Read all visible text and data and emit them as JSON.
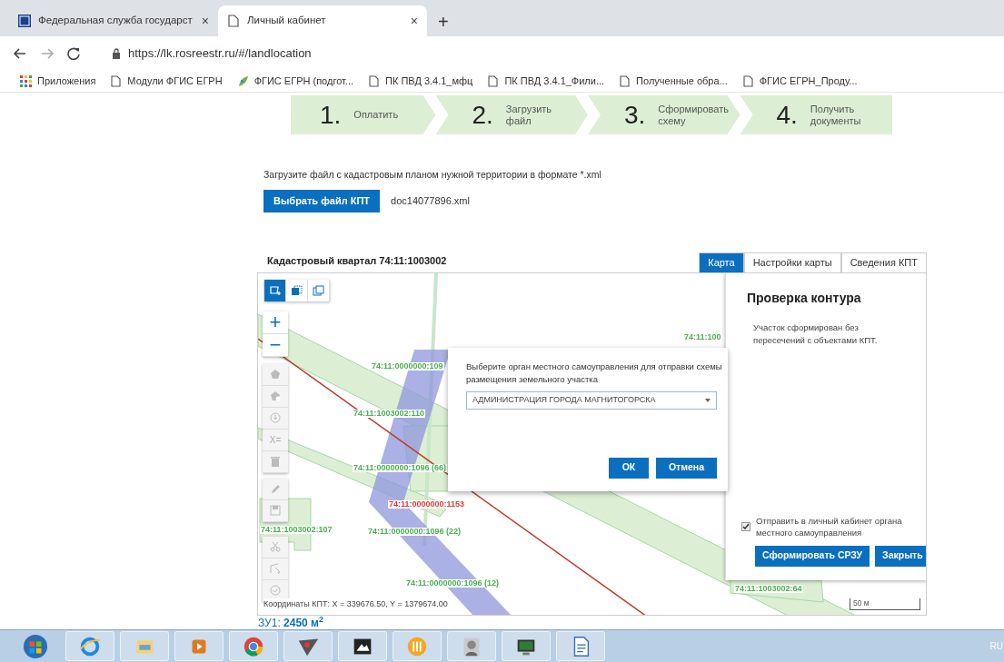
{
  "browser": {
    "tabs": [
      {
        "title": "Федеральная служба государст",
        "kind": "site",
        "selected": false,
        "close": "×"
      },
      {
        "title": "Личный кабинет",
        "kind": "page",
        "selected": true,
        "close": "×"
      }
    ],
    "new_tab": "+",
    "url": "https://lk.rosreestr.ru/#/landlocation",
    "bookmarks": [
      {
        "label": "Приложения",
        "kind": "apps"
      },
      {
        "label": "Модули ФГИС ЕГРН",
        "kind": "page"
      },
      {
        "label": "ФГИС ЕГРН (подгот...",
        "kind": "leaf"
      },
      {
        "label": "ПК ПВД 3.4.1_мфц",
        "kind": "page"
      },
      {
        "label": "ПК ПВД 3.4.1_Фили...",
        "kind": "page"
      },
      {
        "label": "Полученные обра...",
        "kind": "page"
      },
      {
        "label": "ФГИС ЕГРН_Проду...",
        "kind": "page"
      }
    ]
  },
  "steps": [
    {
      "number": "1.",
      "label": "Оплатить"
    },
    {
      "number": "2.",
      "label": "Загрузить файл"
    },
    {
      "number": "3.",
      "label": "Сформировать схему"
    },
    {
      "number": "4.",
      "label": "Получить документы"
    }
  ],
  "upload": {
    "prompt": "Загрузите файл с кадастровым планом нужной территории в формате *.xml",
    "button": "Выбрать файл КПТ",
    "file_name": "doc14077896.xml"
  },
  "map": {
    "title": "Кадастровый квартал 74:11:1003002",
    "tabs": [
      {
        "label": "Карта",
        "selected": true
      },
      {
        "label": "Настройки карты",
        "selected": false
      },
      {
        "label": "Сведения КПТ",
        "selected": false
      }
    ],
    "modes": [
      {
        "kind": "draw",
        "selected": true
      },
      {
        "kind": "select",
        "selected": false
      },
      {
        "kind": "layers",
        "selected": false
      }
    ],
    "zoom": [
      "+",
      "−"
    ],
    "tool_groups": [
      [
        {
          "kind": "polygon"
        },
        {
          "kind": "polygon-hole"
        },
        {
          "kind": "import"
        },
        {
          "kind": "coords",
          "label": "X="
        },
        {
          "kind": "delete"
        }
      ],
      [
        {
          "kind": "edit"
        },
        {
          "kind": "save"
        }
      ],
      [
        {
          "kind": "cut"
        },
        {
          "kind": "vertex"
        },
        {
          "kind": "check"
        }
      ]
    ],
    "labels": [
      {
        "text": "74:11:0000000:109",
        "color": "#4caf50"
      },
      {
        "text": "74:11:1003002:110",
        "color": "#4caf50"
      },
      {
        "text": "74:11:0000000:1096 (66)",
        "color": "#4caf50"
      },
      {
        "text": "74:11:0000000:1153",
        "color": "#e53935"
      },
      {
        "text": "74:11:1003002:107",
        "color": "#4caf50"
      },
      {
        "text": "74:11:0000000:1096 (22)",
        "color": "#4caf50"
      },
      {
        "text": "74:11:0000000:1096 (12)",
        "color": "#4caf50"
      },
      {
        "text": "74:11:100",
        "color": "#4caf50"
      },
      {
        "text": "74:11:1003002:64",
        "color": "#4caf50"
      }
    ],
    "coordinates": "Координаты КПТ: X = 339676.50, Y = 1379674.00",
    "scale": "50 м",
    "dialog": {
      "message": "Выберите орган местного самоуправления для отправки схемы размещения земельного участка",
      "select_value": "АДМИНИСТРАЦИЯ ГОРОДА МАГНИТОГОРСКА",
      "buttons": [
        "ОК",
        "Отмена"
      ]
    },
    "panel": {
      "title": "Проверка контура",
      "message": "Участок сформирован без пересечений с объектами КПТ.",
      "checkbox": {
        "label": "Отправить в личный кабинет органа местного самоуправления",
        "checked": true
      },
      "buttons": [
        "Сформировать СРЗУ",
        "Закрыть"
      ]
    }
  },
  "area": "ЗУ1: **2450 м$^{2}$**",
  "taskbar": {
    "apps": [
      {
        "kind": "start"
      },
      {
        "kind": "ie"
      },
      {
        "kind": "folder"
      },
      {
        "kind": "media"
      },
      {
        "kind": "chrome"
      },
      {
        "kind": "triangle"
      },
      {
        "kind": "dark"
      },
      {
        "kind": "orange"
      },
      {
        "kind": "person"
      },
      {
        "kind": "monitor"
      },
      {
        "kind": "document"
      }
    ],
    "language": "RU"
  }
}
